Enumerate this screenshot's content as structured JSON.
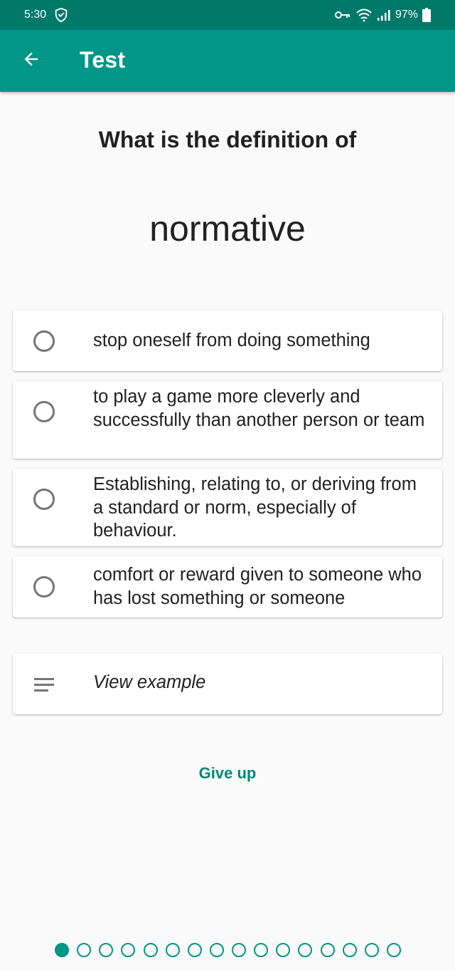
{
  "status_bar": {
    "time": "5:30",
    "battery_percent": "97%",
    "icons": [
      "shield-icon",
      "vpn-key-icon",
      "wifi-icon",
      "signal-icon",
      "battery-icon"
    ]
  },
  "app_bar": {
    "title": "Test",
    "back_icon": "arrow-back-icon",
    "color": "#009688",
    "status_color": "#00796b"
  },
  "question": {
    "prompt": "What is the definition of",
    "word": "normative"
  },
  "options": [
    {
      "label": "stop oneself from doing something"
    },
    {
      "label": "to play a game more cleverly and successfully than another person or team"
    },
    {
      "label": "Establishing, relating to, or deriving from a standard or norm, especially of behaviour."
    },
    {
      "label": "comfort or reward given to someone who has lost something or someone"
    }
  ],
  "example": {
    "label": "View example",
    "icon": "notes-icon"
  },
  "give_up": {
    "label": "Give up"
  },
  "pager": {
    "total": 16,
    "current": 1,
    "accent": "#009688"
  }
}
